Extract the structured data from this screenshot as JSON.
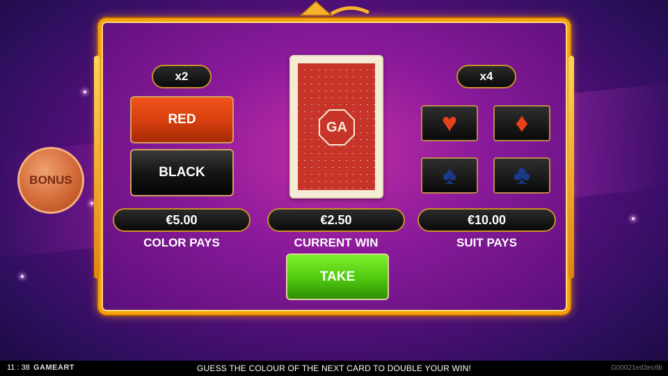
{
  "game": {
    "left_multiplier": "x2",
    "right_multiplier": "x4",
    "color_buttons": {
      "red": "RED",
      "black": "BLACK"
    },
    "card_logo": "GA",
    "suits": [
      {
        "name": "hearts",
        "symbol": "♥",
        "color": "#e8401a"
      },
      {
        "name": "diamonds",
        "symbol": "♦",
        "color": "#e8401a"
      },
      {
        "name": "spades",
        "symbol": "♠",
        "color": "#1b3a8a"
      },
      {
        "name": "clubs",
        "symbol": "♣",
        "color": "#1b3a8a"
      }
    ],
    "color_pays": {
      "value": "€5.00",
      "label": "COLOR PAYS"
    },
    "current_win": {
      "value": "€2.50",
      "label": "CURRENT WIN"
    },
    "suit_pays": {
      "value": "€10.00",
      "label": "SUIT PAYS"
    },
    "take_label": "TAKE",
    "bonus_label": "BONUS"
  },
  "bottom_bar": {
    "time": "11 : 38",
    "brand": "GAMEART",
    "message": "GUESS THE COLOUR OF THE NEXT CARD TO DOUBLE YOUR WIN!",
    "round_id": "G00021ed3ec6b"
  },
  "colors": {
    "frame_gold": "#f6a20e",
    "red_button": "#d8400e",
    "take_button": "#4fc70f"
  }
}
